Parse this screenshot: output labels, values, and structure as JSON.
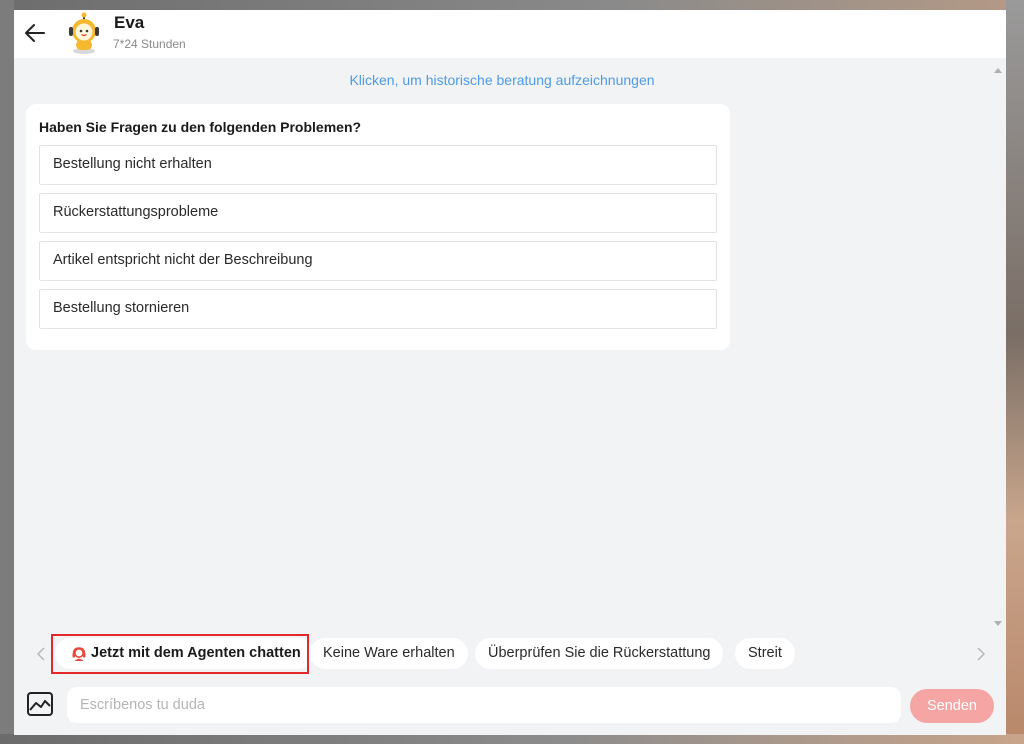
{
  "header": {
    "name": "Eva",
    "hours": "7*24 Stunden",
    "back_icon": "arrow-left-icon",
    "avatar_icon": "robot-avatar-icon"
  },
  "history_link": "Klicken, um historische beratung aufzeichnungen",
  "faq": {
    "title": "Haben Sie Fragen zu den folgenden Problemen?",
    "items": [
      "Bestellung nicht erhalten",
      "Rückerstattungsprobleme",
      "Artikel entspricht nicht der Beschreibung",
      "Bestellung stornieren"
    ]
  },
  "quick_replies": {
    "agent": "Jetzt mit dem Agenten chatten",
    "items": [
      "Keine Ware erhalten",
      "Überprüfen Sie die Rückerstattung",
      "Streit"
    ],
    "agent_icon": "headset-agent-icon",
    "agent_icon_color": "#e8453c"
  },
  "composer": {
    "placeholder": "Escríbenos tu duda",
    "send_label": "Senden",
    "image_icon": "image-icon"
  },
  "colors": {
    "link": "#4d9be8",
    "send_button": "#f6a5a5",
    "highlight": "#e3282b",
    "panel_bg": "#f2f3f5"
  }
}
